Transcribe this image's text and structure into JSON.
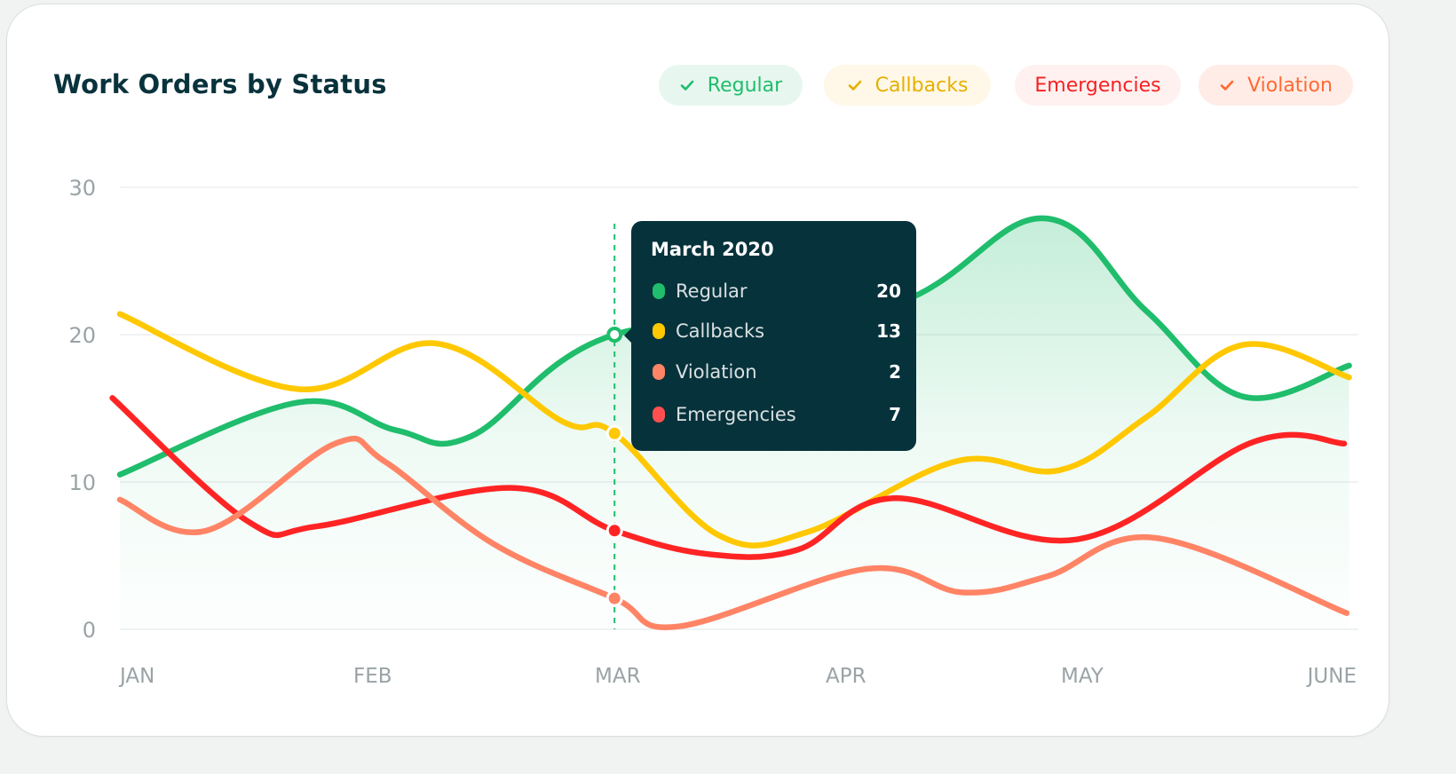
{
  "card": {
    "title": "Work Orders by Status"
  },
  "legend": [
    {
      "key": "regular",
      "label": "Regular",
      "checked": true,
      "color": "#1fbd6c",
      "bg": "#e7f7ef",
      "text_color": "#1fbd6c"
    },
    {
      "key": "callbacks",
      "label": "Callbacks",
      "checked": true,
      "color": "#f4bd00",
      "bg": "#fff8e8",
      "text_color": "#e6b000"
    },
    {
      "key": "emergencies",
      "label": "Emergencies",
      "checked": false,
      "color": "#ff2424",
      "bg": "#fff1f0",
      "text_color": "#f52222"
    },
    {
      "key": "violation",
      "label": "Violation",
      "checked": true,
      "color": "#ff8466",
      "bg": "#ffece6",
      "text_color": "#ff6a33"
    }
  ],
  "tooltip": {
    "title": "March 2020",
    "rows": [
      {
        "label": "Regular",
        "value": "20",
        "color": "#1fbd6c"
      },
      {
        "label": "Callbacks",
        "value": "13",
        "color": "#ffc800"
      },
      {
        "label": "Violation",
        "value": "2",
        "color": "#ff8466"
      },
      {
        "label": "Emergencies",
        "value": "7",
        "color": "#ff4f4f"
      }
    ]
  },
  "chart_data": {
    "type": "line",
    "title": "Work Orders by Status",
    "xlabel": "",
    "ylabel": "",
    "categories": [
      "JAN",
      "FEB",
      "MAR",
      "APR",
      "MAY",
      "JUNE"
    ],
    "ylim": [
      0,
      30
    ],
    "yticks": [
      0,
      10,
      20,
      30
    ],
    "grid": true,
    "legend_position": "top-right",
    "hover_category": "MAR",
    "series": [
      {
        "name": "Regular",
        "key": "regular",
        "color": "#1fbd6c",
        "area_fill": true,
        "points": [
          [
            0,
            10.5
          ],
          [
            0.72,
            15.4
          ],
          [
            1.12,
            13.5
          ],
          [
            1.42,
            13.1
          ],
          [
            2,
            20
          ],
          [
            3.1,
            21.9
          ],
          [
            3.73,
            27.9
          ],
          [
            4.15,
            21.6
          ],
          [
            4.54,
            15.8
          ],
          [
            4.97,
            17.9
          ]
        ]
      },
      {
        "name": "Callbacks",
        "key": "callbacks",
        "color": "#ffc800",
        "area_fill": false,
        "points": [
          [
            0,
            21.4
          ],
          [
            0.72,
            16.3
          ],
          [
            1.28,
            19.4
          ],
          [
            1.79,
            14.1
          ],
          [
            2,
            13.3
          ],
          [
            2.42,
            6.4
          ],
          [
            2.78,
            6.6
          ],
          [
            3.38,
            11.4
          ],
          [
            3.8,
            10.8
          ],
          [
            4.15,
            14.4
          ],
          [
            4.54,
            19.3
          ],
          [
            4.97,
            17.1
          ]
        ]
      },
      {
        "name": "Emergencies",
        "key": "emergencies",
        "color": "#ff2424",
        "area_fill": false,
        "points": [
          [
            -0.03,
            15.7
          ],
          [
            0.52,
            7.3
          ],
          [
            0.8,
            7.0
          ],
          [
            1.58,
            9.6
          ],
          [
            2,
            6.7
          ],
          [
            2.38,
            5.1
          ],
          [
            2.74,
            5.4
          ],
          [
            3.13,
            8.9
          ],
          [
            3.87,
            6.1
          ],
          [
            4.58,
            12.7
          ],
          [
            4.95,
            12.6
          ]
        ]
      },
      {
        "name": "Violation",
        "key": "violation",
        "color": "#ff8466",
        "area_fill": false,
        "points": [
          [
            0,
            8.8
          ],
          [
            0.35,
            6.7
          ],
          [
            0.87,
            12.6
          ],
          [
            1.07,
            11.4
          ],
          [
            1.51,
            5.8
          ],
          [
            2,
            2.1
          ],
          [
            2.26,
            0.2
          ],
          [
            3.02,
            4.1
          ],
          [
            3.41,
            2.5
          ],
          [
            3.75,
            3.6
          ],
          [
            4.19,
            6.2
          ],
          [
            4.96,
            1.1
          ]
        ]
      }
    ]
  }
}
